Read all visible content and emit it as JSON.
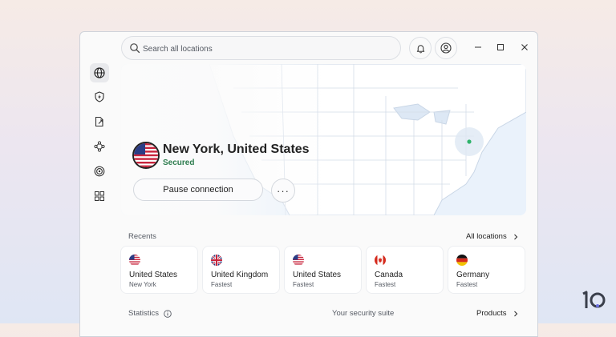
{
  "search": {
    "placeholder": "Search all locations"
  },
  "icons": {
    "search": "search-icon",
    "notifications": "bell-icon",
    "account": "user-icon",
    "minimize": "minimize-icon",
    "maximize": "maximize-icon",
    "close": "close-icon"
  },
  "sidebar": {
    "items": [
      {
        "icon": "globe-icon",
        "active": true
      },
      {
        "icon": "shield-bolt-icon",
        "active": false
      },
      {
        "icon": "split-tunnel-icon",
        "active": false
      },
      {
        "icon": "meshnet-icon",
        "active": false
      },
      {
        "icon": "target-icon",
        "active": false
      },
      {
        "icon": "apps-grid-icon",
        "active": false
      }
    ]
  },
  "connection": {
    "location": "New York, United States",
    "status": "Secured",
    "pause_label": "Pause connection",
    "more_label": "···"
  },
  "recents": {
    "title": "Recents",
    "all_locations": "All locations",
    "items": [
      {
        "country": "United States",
        "detail": "New York",
        "flag": "us"
      },
      {
        "country": "United Kingdom",
        "detail": "Fastest",
        "flag": "uk"
      },
      {
        "country": "United States",
        "detail": "Fastest",
        "flag": "us"
      },
      {
        "country": "Canada",
        "detail": "Fastest",
        "flag": "ca"
      },
      {
        "country": "Germany",
        "detail": "Fastest",
        "flag": "de"
      }
    ]
  },
  "footer": {
    "statistics": "Statistics",
    "security_suite": "Your security suite",
    "products": "Products"
  },
  "colors": {
    "accent_green": "#2e7d4f",
    "map_background": "#eaf2fb",
    "connected_dot": "#2fb36b"
  },
  "watermark": "10"
}
